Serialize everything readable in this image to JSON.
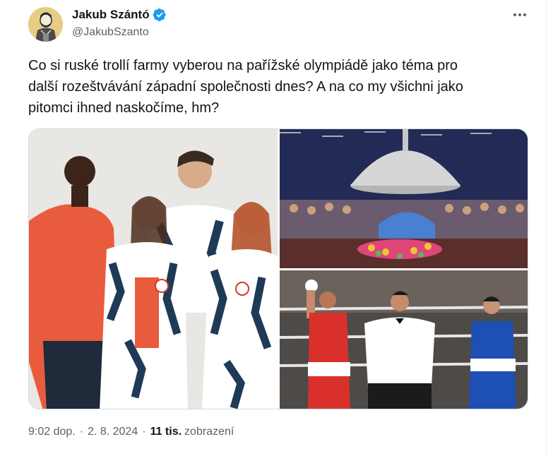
{
  "author": {
    "display_name": "Jakub Szántó",
    "handle": "@JakubSzanto",
    "verified": true,
    "avatar_icon": "avatar-illustration-icon"
  },
  "tweet": {
    "text": "Co si ruské trollí farmy vyberou na pařížské olympiádě jako téma pro\ndalší rozeštvávání západní společnosti dnes? A na co my všichni jako\npitomci ihned naskočíme, hm?"
  },
  "media": {
    "photos": [
      {
        "name": "team-uniforms-photo"
      },
      {
        "name": "opening-ceremony-photo"
      },
      {
        "name": "boxing-match-photo"
      }
    ]
  },
  "meta": {
    "time": "9:02 dop.",
    "date": "2. 8. 2024",
    "views_count": "11 tis.",
    "views_label": "zobrazení"
  },
  "colors": {
    "text_primary": "#0f1419",
    "text_secondary": "#536471",
    "verified_blue": "#1d9bf0",
    "border": "#cfd9de"
  }
}
